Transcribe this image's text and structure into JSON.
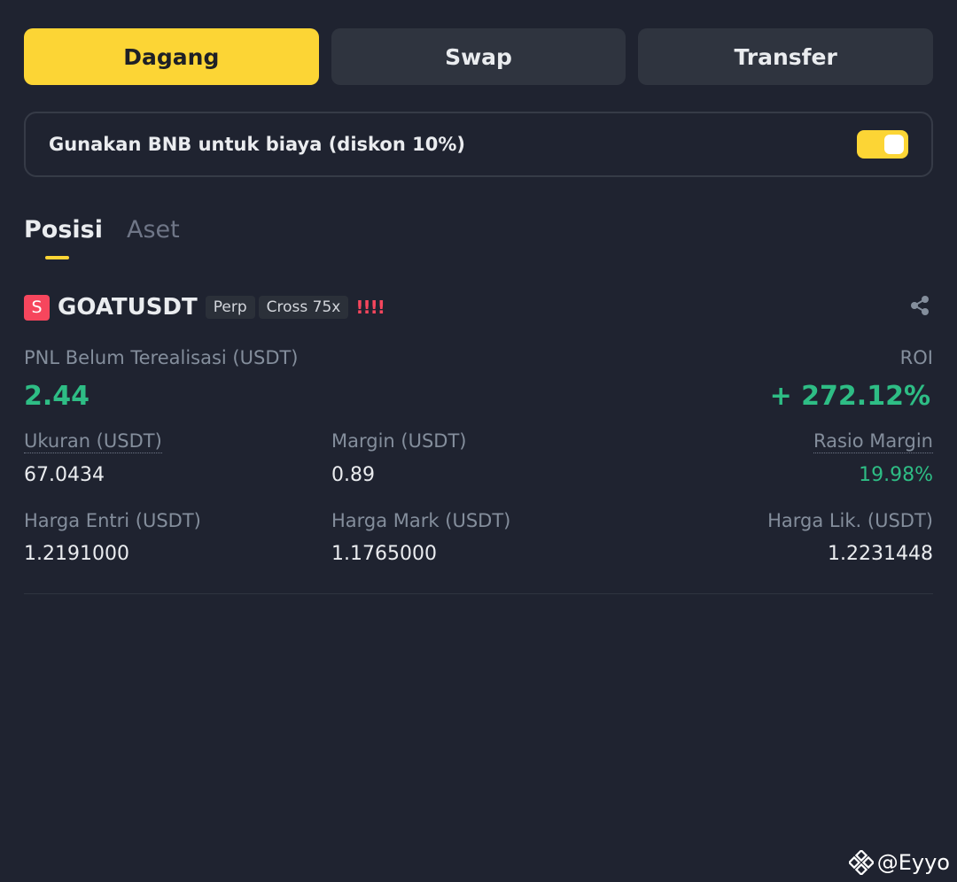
{
  "actions": {
    "trade_label": "Dagang",
    "swap_label": "Swap",
    "transfer_label": "Transfer"
  },
  "bnb_fee": {
    "label": "Gunakan BNB untuk biaya (diskon 10%)",
    "enabled": true
  },
  "tabs": [
    {
      "label": "Posisi",
      "active": true
    },
    {
      "label": "Aset",
      "active": false
    }
  ],
  "position": {
    "side_badge": "S",
    "symbol": "GOATUSDT",
    "type_tag": "Perp",
    "margin_tag": "Cross 75x",
    "warning": "!!!!",
    "pnl_label": "PNL Belum Terealisasi (USDT)",
    "pnl_value": "2.44",
    "roi_label": "ROI",
    "roi_value": "+ 272.12%",
    "size_label": "Ukuran (USDT)",
    "size_value": "67.0434",
    "margin_label": "Margin (USDT)",
    "margin_value": "0.89",
    "margin_ratio_label": "Rasio Margin",
    "margin_ratio_value": "19.98%",
    "entry_label": "Harga Entri (USDT)",
    "entry_value": "1.2191000",
    "mark_label": "Harga Mark (USDT)",
    "mark_value": "1.1765000",
    "liq_label": "Harga Lik. (USDT)",
    "liq_value": "1.2231448"
  },
  "watermark": "@Eyyo",
  "colors": {
    "accent": "#fcd535",
    "positive": "#2ebd85",
    "negative": "#f6465d",
    "background": "#1f2330"
  }
}
